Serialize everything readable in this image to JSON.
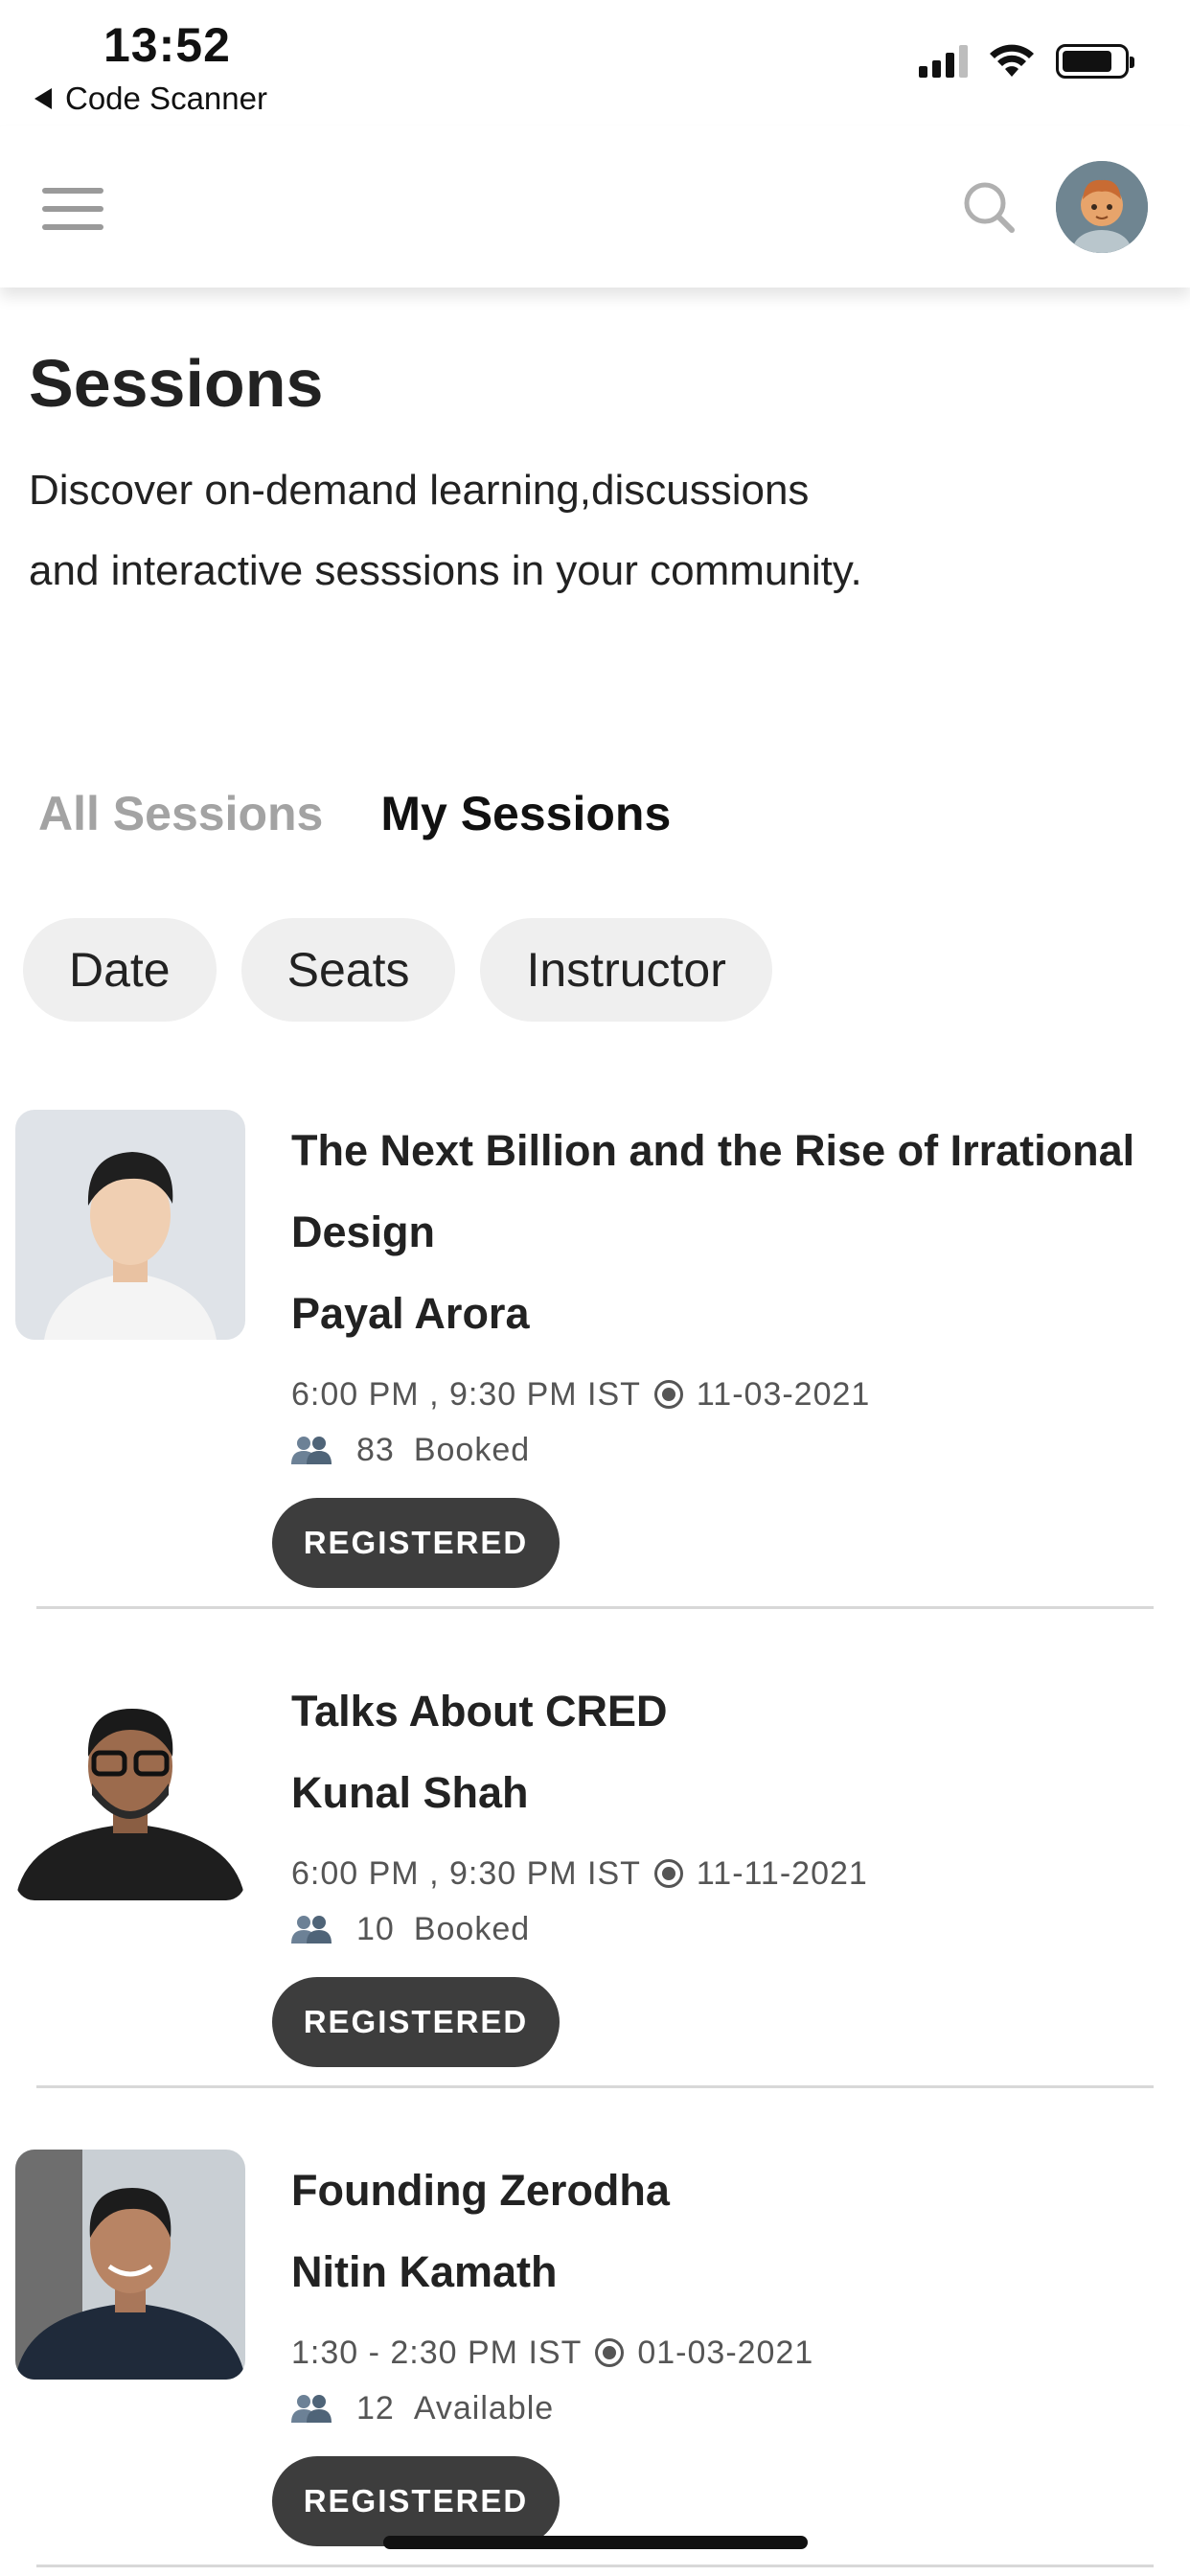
{
  "status_bar": {
    "time": "13:52",
    "back_app": "Code Scanner"
  },
  "header": {
    "menu_icon": "hamburger-icon",
    "search_icon": "search-icon",
    "avatar_icon": "user-avatar"
  },
  "intro": {
    "title": "Sessions",
    "description": "Discover on-demand learning,discussions and interactive sesssions in your community."
  },
  "tabs": [
    {
      "label": "All Sessions",
      "active": false
    },
    {
      "label": "My Sessions",
      "active": true
    }
  ],
  "filters": [
    {
      "label": "Date"
    },
    {
      "label": "Seats"
    },
    {
      "label": "Instructor"
    }
  ],
  "sessions": [
    {
      "title": "The Next Billion and the Rise of Irrational Design",
      "speaker": "Payal Arora",
      "time": "6:00 PM , 9:30 PM IST",
      "date": "11-03-2021",
      "seats_count": "83",
      "seats_status": "Booked",
      "button_label": "REGISTERED"
    },
    {
      "title": "Talks About CRED",
      "speaker": "Kunal Shah",
      "time": "6:00 PM , 9:30 PM IST",
      "date": "11-11-2021",
      "seats_count": "10",
      "seats_status": "Booked",
      "button_label": "REGISTERED"
    },
    {
      "title": "Founding Zerodha",
      "speaker": "Nitin Kamath",
      "time": "1:30 - 2:30 PM IST",
      "date": "01-03-2021",
      "seats_count": "12",
      "seats_status": "Available",
      "button_label": "REGISTERED"
    }
  ],
  "colors": {
    "button_bg": "#3d3d3d",
    "chip_bg": "#efefef",
    "inactive_tab": "#a3a3a3",
    "avatar_bg": "#6f8591"
  }
}
